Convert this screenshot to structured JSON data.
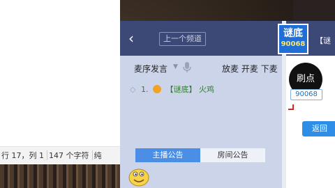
{
  "editor": {
    "status": {
      "position": "行 17，列 1",
      "chars": "147 个字符",
      "extra": "纯"
    }
  },
  "panel": {
    "prev_channel_label": "上一个频道",
    "queue_mode_label": "麦序发言",
    "mic_actions": [
      "放麦",
      "开麦",
      "下麦"
    ],
    "queue": [
      {
        "index": "1.",
        "tag": "【谜底】",
        "name": "火鸡"
      }
    ],
    "tabs": [
      {
        "label": "主播公告",
        "active": true
      },
      {
        "label": "房间公告",
        "active": false
      }
    ]
  },
  "info": {
    "logo_line1": "谜底",
    "logo_line2": "90068",
    "channel_name": "【谜",
    "avatar_text": "刷点",
    "avatar_id": "90068",
    "return_label": "返回"
  },
  "colors": {
    "header_bg": "#3c4876",
    "panel_bg": "#ccd4ea",
    "tab_active": "#4b8ee6",
    "queue_text": "#2f7d2f",
    "return_btn": "#2e8de6"
  }
}
